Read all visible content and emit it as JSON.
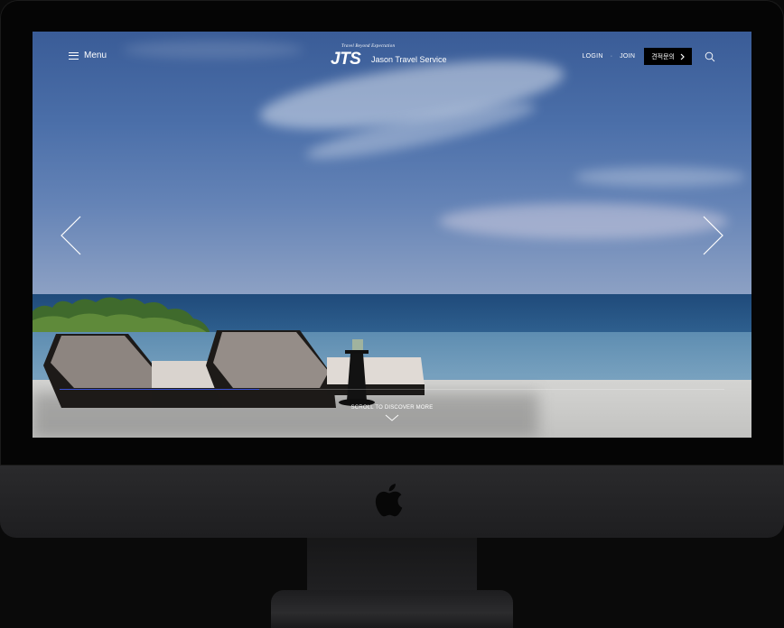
{
  "header": {
    "menu_label": "Menu",
    "logo_tagline": "Travel Beyond Expectation",
    "logo_mark": "JTS",
    "logo_name": "Jason Travel Service",
    "login_label": "LOGIN",
    "separator": "·",
    "join_label": "JOIN",
    "quote_label": "견적문의"
  },
  "hero": {
    "scroll_label": "SCROLL TO DISCOVER MORE",
    "progress": 0.3
  },
  "icons": {
    "menu": "hamburger-icon",
    "search": "search-icon",
    "prev": "chevron-left-icon",
    "next": "chevron-right-icon",
    "quote_arrow": "chevron-right-icon",
    "scroll": "chevron-down-icon",
    "device_logo": "apple-logo"
  },
  "colors": {
    "accent": "#3b52d6",
    "quote_button_bg": "#000000"
  }
}
